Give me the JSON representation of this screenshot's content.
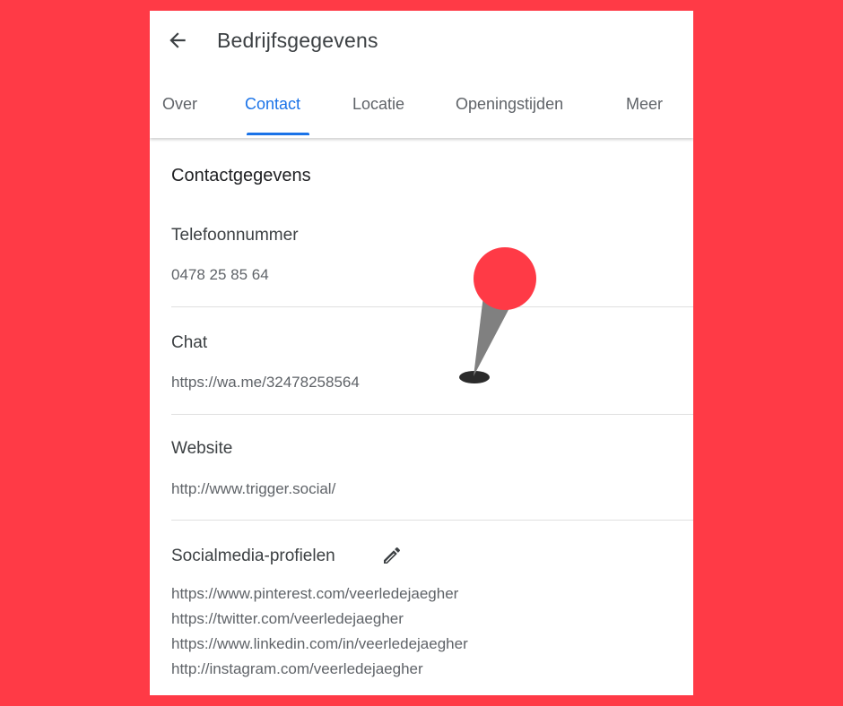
{
  "header": {
    "title": "Bedrijfsgegevens"
  },
  "tabs": [
    {
      "label": "Over"
    },
    {
      "label": "Contact"
    },
    {
      "label": "Locatie"
    },
    {
      "label": "Openingstijden"
    },
    {
      "label": "Meer"
    }
  ],
  "contact": {
    "section_title": "Contactgegevens",
    "phone_label": "Telefoonnummer",
    "phone_value": "0478 25 85 64",
    "chat_label": "Chat",
    "chat_value": "https://wa.me/32478258564",
    "website_label": "Website",
    "website_value": "http://www.trigger.social/",
    "social_label": "Socialmedia-profielen",
    "social_links": [
      "https://www.pinterest.com/veerledejaegher",
      "https://twitter.com/veerledejaegher",
      "https://www.linkedin.com/in/veerledejaegher",
      "http://instagram.com/veerledejaegher"
    ]
  },
  "icons": {
    "back": "arrow-back-icon",
    "edit": "pencil-icon",
    "pin": "map-pin-icon"
  },
  "colors": {
    "background": "#ff3a46",
    "accent": "#1a73e8",
    "pin_head": "#ff3a46",
    "pin_needle": "#808080"
  }
}
